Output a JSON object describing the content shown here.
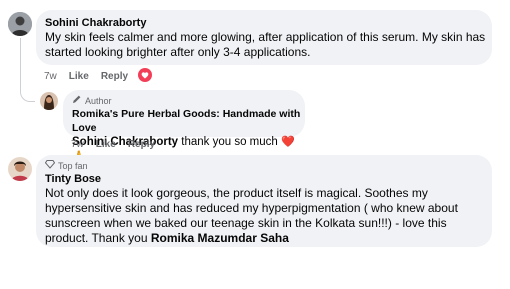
{
  "comments": [
    {
      "author": "Sohini Chakraborty",
      "text": "My skin feels calmer and more glowing, after application of this serum. My skin has started looking brighter after only 3-4 applications.",
      "time": "7w",
      "like": "Like",
      "reply": "Reply",
      "reaction": "heart-reaction"
    },
    {
      "badge": "Author",
      "author": "Romika's Pure Herbal Goods: Handmade with Love",
      "mention": "Sohini Chakraborty",
      "text": " thank you so much ",
      "emojis": "❤️🙏",
      "time": "7w",
      "like": "Like",
      "reply": "Reply"
    },
    {
      "badge": "Top fan",
      "author": "Tinty Bose",
      "text": "Not only does it look gorgeous, the product itself is magical. Soothes my hypersensitive skin and has reduced my hyperpigmentation ( who knew about sunscreen when we baked our teenage skin in the Kolkata sun!!!) - love this product. Thank you ",
      "mention": "Romika Mazumdar Saha"
    }
  ],
  "colors": {
    "bubble": "#f0f2f5",
    "meta": "#65676b",
    "heart": "#e41e3f"
  }
}
